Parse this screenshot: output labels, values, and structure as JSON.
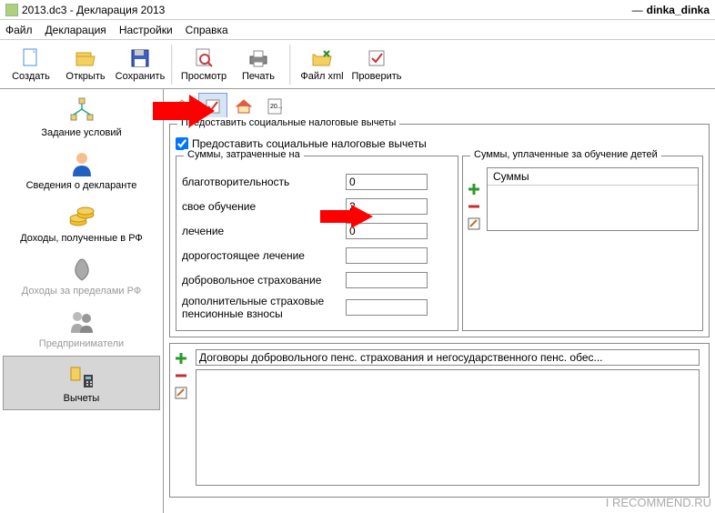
{
  "window": {
    "title": "2013.dc3 - Декларация 2013",
    "user": "dinka_dinka"
  },
  "menu": {
    "file": "Файл",
    "declaration": "Декларация",
    "settings": "Настройки",
    "help": "Справка"
  },
  "toolbar": {
    "create": "Создать",
    "open": "Открыть",
    "save": "Сохранить",
    "preview": "Просмотр",
    "print": "Печать",
    "file_xml": "Файл xml",
    "check": "Проверить"
  },
  "sidebar": {
    "conditions": "Задание условий",
    "declarant": "Сведения о декларанте",
    "income_rf": "Доходы, полученные в РФ",
    "income_abroad": "Доходы за пределами РФ",
    "entrepreneurs": "Предприниматели",
    "deductions": "Вычеты"
  },
  "mini": {
    "year": "20..."
  },
  "group": {
    "provide_title": "Предоставить социальные налоговые вычеты",
    "provide_checkbox": "Предоставить социальные налоговые вычеты",
    "sums_spent_title": "Суммы, затраченные на",
    "charity": "благотворительность",
    "own_edu": "свое обучение",
    "treatment": "лечение",
    "expensive_treatment": "дорогостоящее лечение",
    "voluntary_ins": "добровольное страхование",
    "additional_ins": "дополнительные страховые пенсионные взносы",
    "children_edu_title": "Суммы, уплаченные за обучение детей",
    "children_col": "Суммы"
  },
  "values": {
    "charity": "0",
    "own_edu": "2",
    "treatment": "0",
    "expensive_treatment": "",
    "voluntary_ins": "",
    "additional_ins": ""
  },
  "bottom": {
    "input": "Договоры добровольного пенс. страхования и негосударственного пенс. обес..."
  },
  "watermark": "I RECOMMEND.RU"
}
